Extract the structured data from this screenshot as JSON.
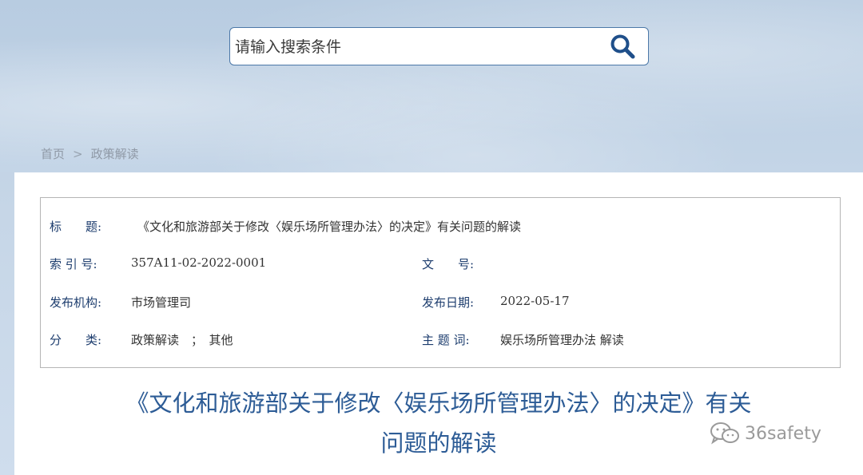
{
  "search": {
    "placeholder": "请输入搜索条件",
    "button_icon": "search-icon"
  },
  "breadcrumb": {
    "home": "首页",
    "separator": ">",
    "current": "政策解读"
  },
  "meta": {
    "title_label": "标　　题:",
    "title_value": "《文化和旅游部关于修改〈娱乐场所管理办法〉的决定》有关问题的解读",
    "index_label": "索 引 号:",
    "index_value": "357A11-02-2022-0001",
    "doc_no_label": "文　　号:",
    "doc_no_value": "",
    "issuer_label": "发布机构:",
    "issuer_value": "市场管理司",
    "date_label": "发布日期:",
    "date_value": "2022-05-17",
    "category_label": "分　　类:",
    "category_value": "政策解读　；　其他",
    "keywords_label": "主 题 词:",
    "keywords_value": "娱乐场所管理办法 解读"
  },
  "article": {
    "title_line1": "《文化和旅游部关于修改〈娱乐场所管理办法〉的决定》有关",
    "title_line2": "问题的解读"
  },
  "watermark": {
    "text": "36safety",
    "icon": "wechat-icon"
  },
  "colors": {
    "accent": "#2d5c96",
    "label": "#1d3d6e",
    "search_border": "#4c78a8"
  }
}
